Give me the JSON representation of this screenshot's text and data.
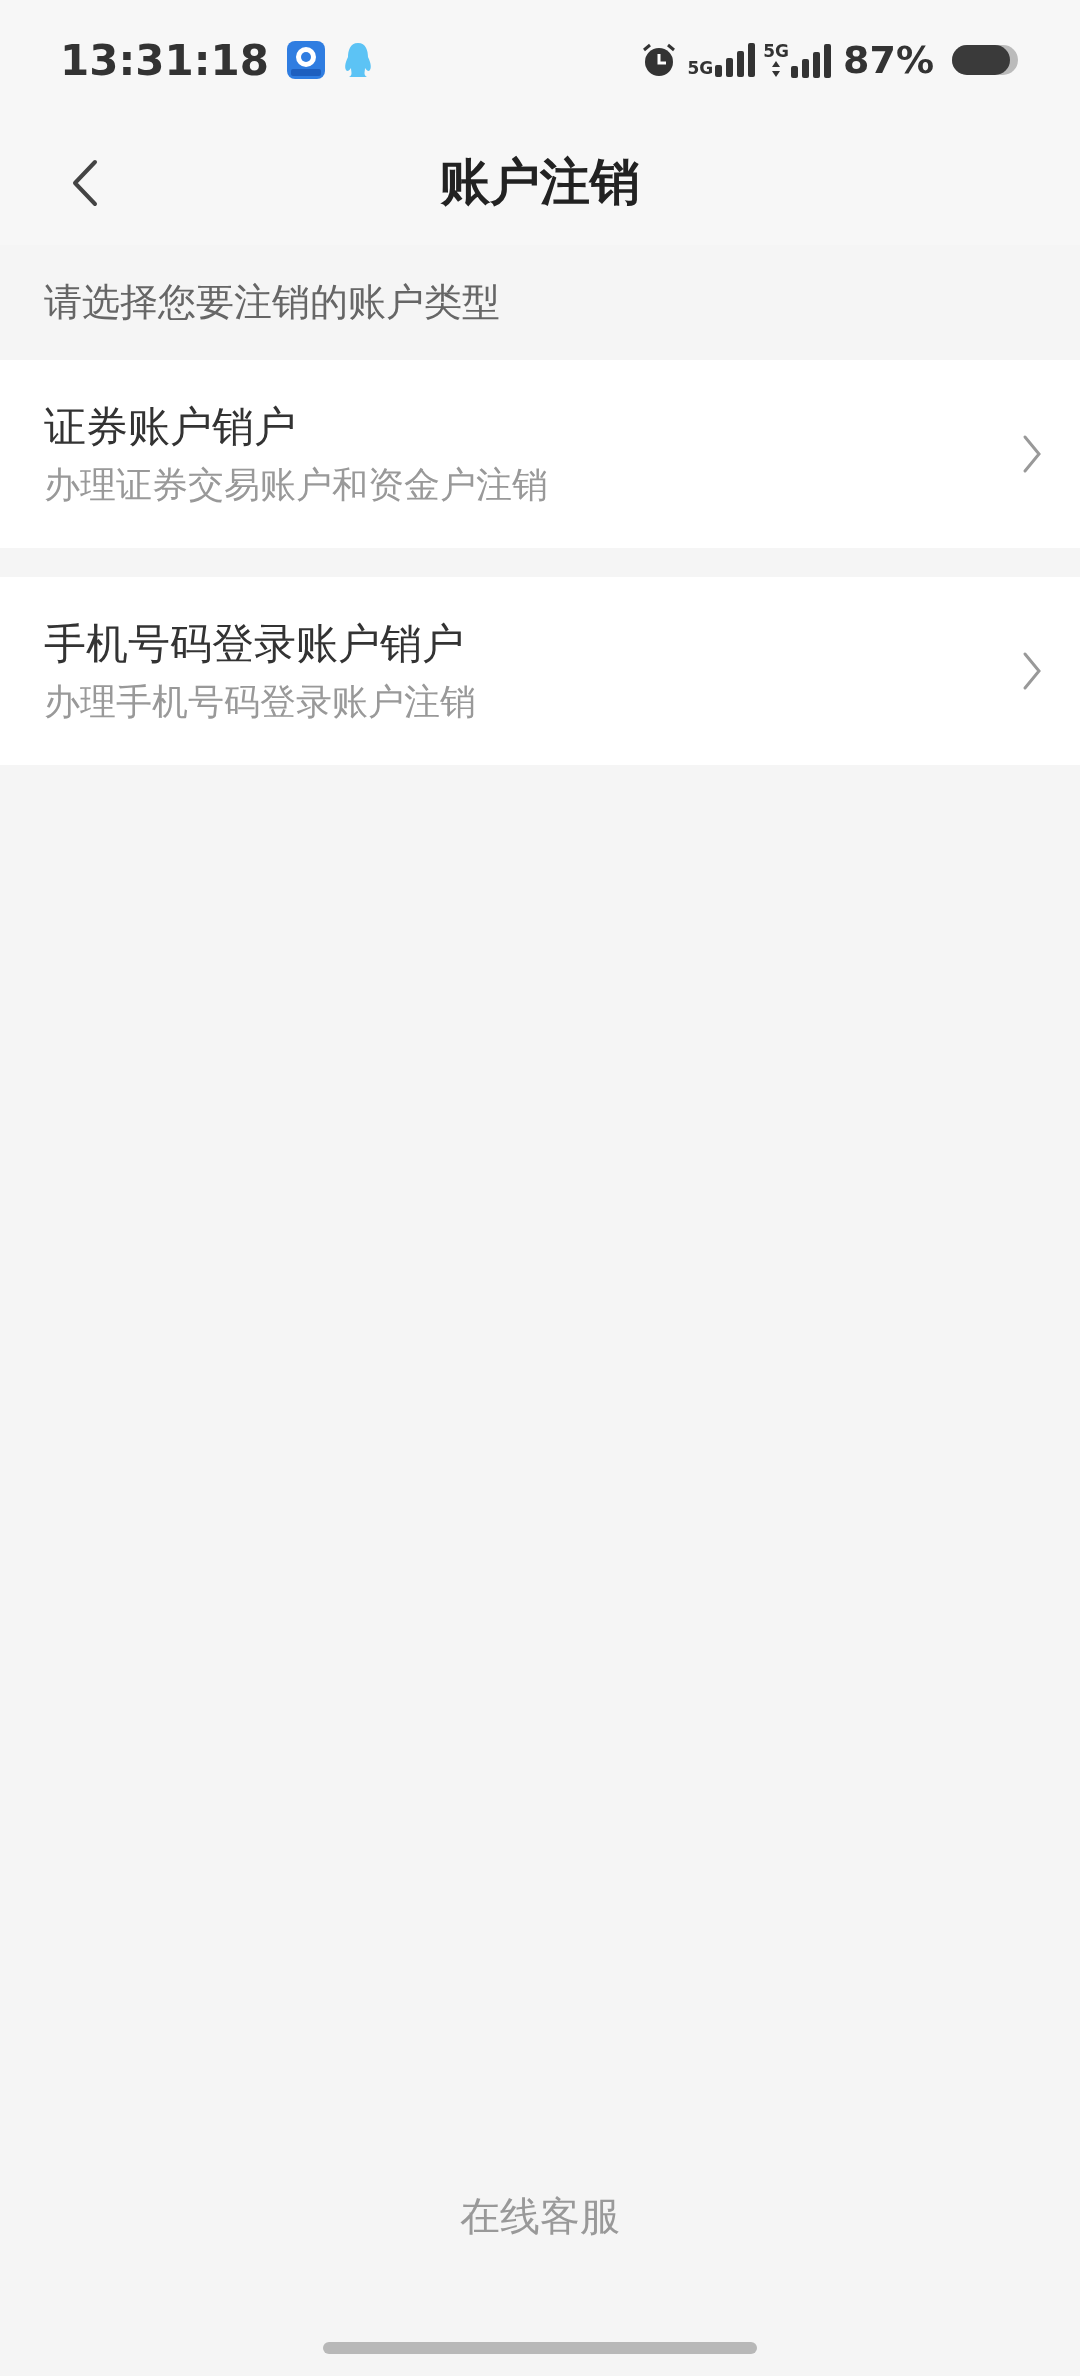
{
  "status_bar": {
    "time": "13:31:18",
    "signals": [
      {
        "label": "5G",
        "kind": "plain"
      },
      {
        "label": "5G",
        "kind": "arrows"
      }
    ],
    "battery": "87%"
  },
  "nav": {
    "title": "账户注销"
  },
  "hint": "请选择您要注销的账户类型",
  "items": [
    {
      "title": "证券账户销户",
      "subtitle": "办理证券交易账户和资金户注销"
    },
    {
      "title": "手机号码登录账户销户",
      "subtitle": "办理手机号码登录账户注销"
    }
  ],
  "footer": {
    "link": "在线客服"
  }
}
